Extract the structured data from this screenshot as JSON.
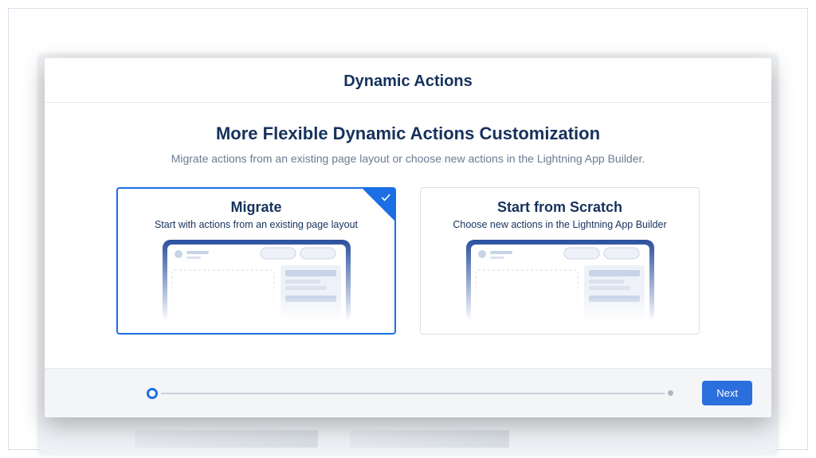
{
  "modal": {
    "title": "Dynamic Actions",
    "subtitle": "More Flexible Dynamic Actions Customization",
    "description": "Migrate actions from an existing page layout or choose new actions in the Lightning App Builder."
  },
  "options": [
    {
      "key": "migrate",
      "title": "Migrate",
      "description": "Start with actions from an existing page layout",
      "selected": true
    },
    {
      "key": "scratch",
      "title": "Start from Scratch",
      "description": "Choose new actions in the Lightning App Builder",
      "selected": false
    }
  ],
  "footer": {
    "next_label": "Next",
    "progress": {
      "current": 1,
      "total": 2
    }
  },
  "colors": {
    "accent": "#1b6ee4",
    "heading": "#16325c",
    "muted": "#6b7b92"
  }
}
